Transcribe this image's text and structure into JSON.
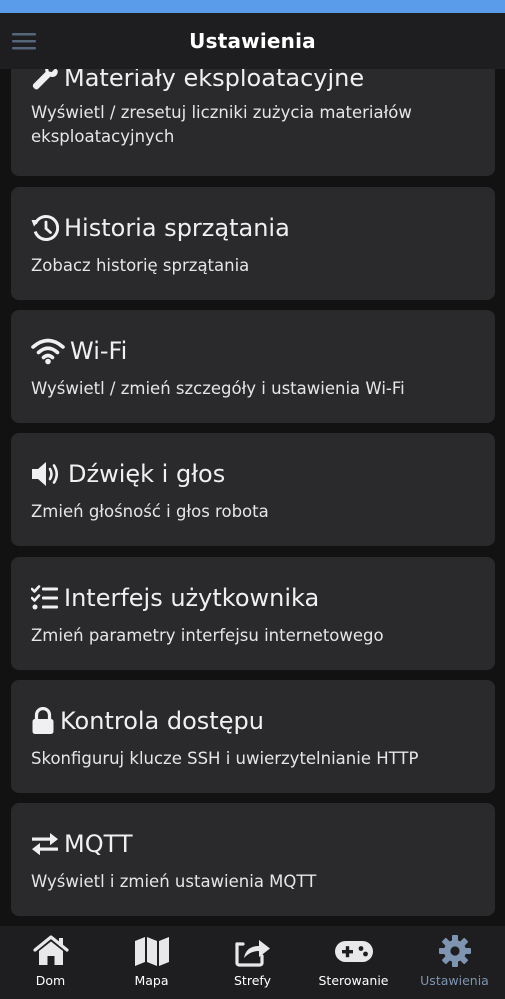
{
  "app_bar": {
    "title": "Ustawienia"
  },
  "cards": [
    {
      "title": "Materiały eksploatacyjne",
      "icon": "wrench-icon",
      "desc_line1": "Wyświetl / zresetuj liczniki zużycia materiałów",
      "desc_line2": "eksploatacyjnych"
    },
    {
      "title": "Historia sprzątania",
      "icon": "history-icon",
      "desc_line1": "Zobacz historię sprzątania"
    },
    {
      "title": "Wi-Fi",
      "icon": "wifi-icon",
      "desc_line1": "Wyświetl / zmień szczegóły i ustawienia Wi-Fi"
    },
    {
      "title": "Dźwięk i głos",
      "icon": "volume-icon",
      "desc_line1": "Zmień głośność i głos robota"
    },
    {
      "title": "Interfejs użytkownika",
      "icon": "checklist-icon",
      "desc_line1": "Zmień parametry interfejsu internetowego"
    },
    {
      "title": "Kontrola dostępu",
      "icon": "lock-icon",
      "desc_line1": "Skonfiguruj klucze SSH i uwierzytelnianie HTTP"
    },
    {
      "title": "MQTT",
      "icon": "exchange-arrows-icon",
      "desc_line1": "Wyświetl i zmień ustawienia MQTT"
    }
  ],
  "nav": [
    {
      "label": "Dom",
      "icon": "home-icon"
    },
    {
      "label": "Mapa",
      "icon": "map-icon"
    },
    {
      "label": "Strefy",
      "icon": "share-icon"
    },
    {
      "label": "Sterowanie",
      "icon": "gamepad-icon"
    },
    {
      "label": "Ustawienia",
      "icon": "gear-icon",
      "active": true
    }
  ],
  "colors": {
    "status_strip": "#5a9bea",
    "background": "#121212",
    "card": "#2a2a2c",
    "active_nav": "#7e94b0"
  }
}
